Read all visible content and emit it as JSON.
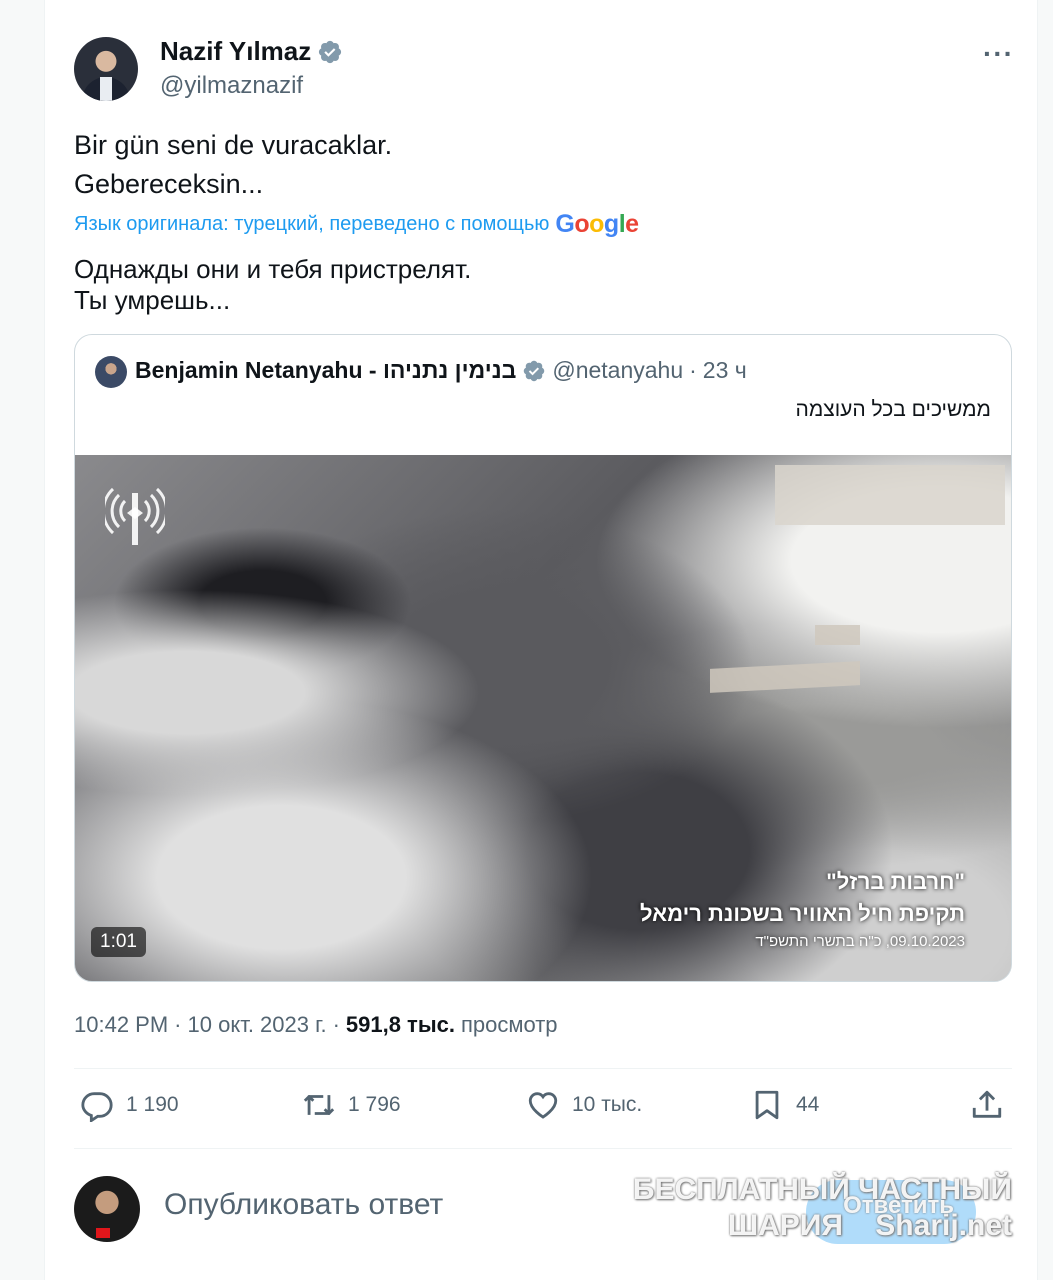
{
  "tweet": {
    "author": {
      "name": "Nazif Yılmaz",
      "handle": "@yilmaznazif",
      "verified": true
    },
    "more_label": "···",
    "text_lines": [
      "Bir gün seni de vuracaklar.",
      "Gebereceksin..."
    ],
    "translation_note": "Язык оригинала: турецкий, переведено с помощью",
    "translation_provider": "Google",
    "translated_lines": [
      "Однажды они и тебя пристрелят.",
      "Ты умрешь..."
    ],
    "time": "10:42 PM",
    "date": "10 окт. 2023 г.",
    "views_count": "591,8 тыс.",
    "views_label": "просмотр"
  },
  "quote": {
    "author_name": "Benjamin Netanyahu - בנימין נתניהו",
    "handle": "@netanyahu",
    "age": "23 ч",
    "text": "ממשיכים בכל העוצמה",
    "video": {
      "duration": "1:01",
      "caption_line1": "\"חרבות ברזל\"",
      "caption_line2": "תקיפת חיל האוויר בשכונת רימאל",
      "caption_line3": "09.10.2023, כ\"ה בתשרי התשפ\"ד"
    }
  },
  "actions": {
    "replies": "1 190",
    "retweets": "1 796",
    "likes": "10 тыс.",
    "bookmarks": "44"
  },
  "reply_box": {
    "placeholder": "Опубликовать ответ"
  },
  "watermark": {
    "line1": "БЕСПЛАТНЫЙ ЧАСТНЫЙ",
    "line2": "ШАРИЯ",
    "line3": "Sharij.net",
    "bubble_text": "Ответить"
  },
  "colors": {
    "accent": "#1d9bf0",
    "secondary_text": "#536471",
    "divider": "#eff3f4"
  },
  "icons": [
    "verified-badge-icon",
    "more-icon",
    "reply-icon",
    "retweet-icon",
    "like-icon",
    "bookmark-icon",
    "share-icon",
    "idf-logo-icon"
  ]
}
